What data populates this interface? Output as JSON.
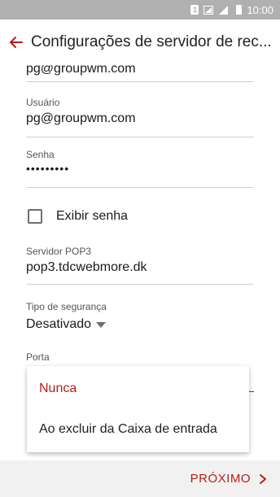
{
  "status_bar": {
    "sim_label": "1",
    "time": "10:00"
  },
  "header": {
    "title": "Configurações de servidor de rec..."
  },
  "form": {
    "email_value": "pg@groupwm.com",
    "username_label": "Usuário",
    "username_value": "pg@groupwm.com",
    "password_label": "Senha",
    "password_value": "•••••••••",
    "show_password_label": "Exibir senha",
    "show_password_checked": false,
    "pop3_label": "Servidor POP3",
    "pop3_value": "pop3.tdcwebmore.dk",
    "security_label": "Tipo de segurança",
    "security_value": "Desativado",
    "port_label": "Porta"
  },
  "dropdown": {
    "options": [
      {
        "label": "Nunca",
        "selected": true
      },
      {
        "label": "Ao excluir da Caixa de entrada",
        "selected": false
      }
    ]
  },
  "footer": {
    "next_label": "PRÓXIMO"
  },
  "colors": {
    "accent": "#b71c1c",
    "status_bar": "#b0b0b0",
    "bottom_bar": "#f1f1f1"
  }
}
